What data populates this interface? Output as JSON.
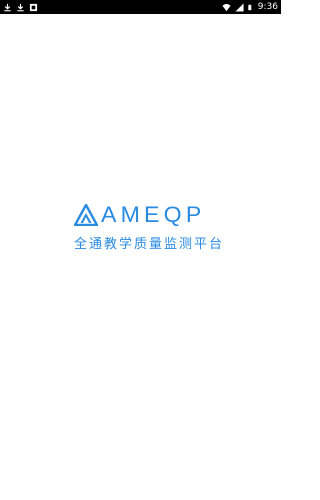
{
  "status_bar": {
    "time": "9:36",
    "left_icons": [
      "download-icon",
      "download-icon",
      "app-notification-icon"
    ],
    "right_icons": [
      "wifi-icon",
      "signal-icon",
      "battery-icon"
    ]
  },
  "splash": {
    "brand": "AMEQP",
    "tagline": "全通教学质量监测平台",
    "accent_color": "#2a8be0"
  }
}
